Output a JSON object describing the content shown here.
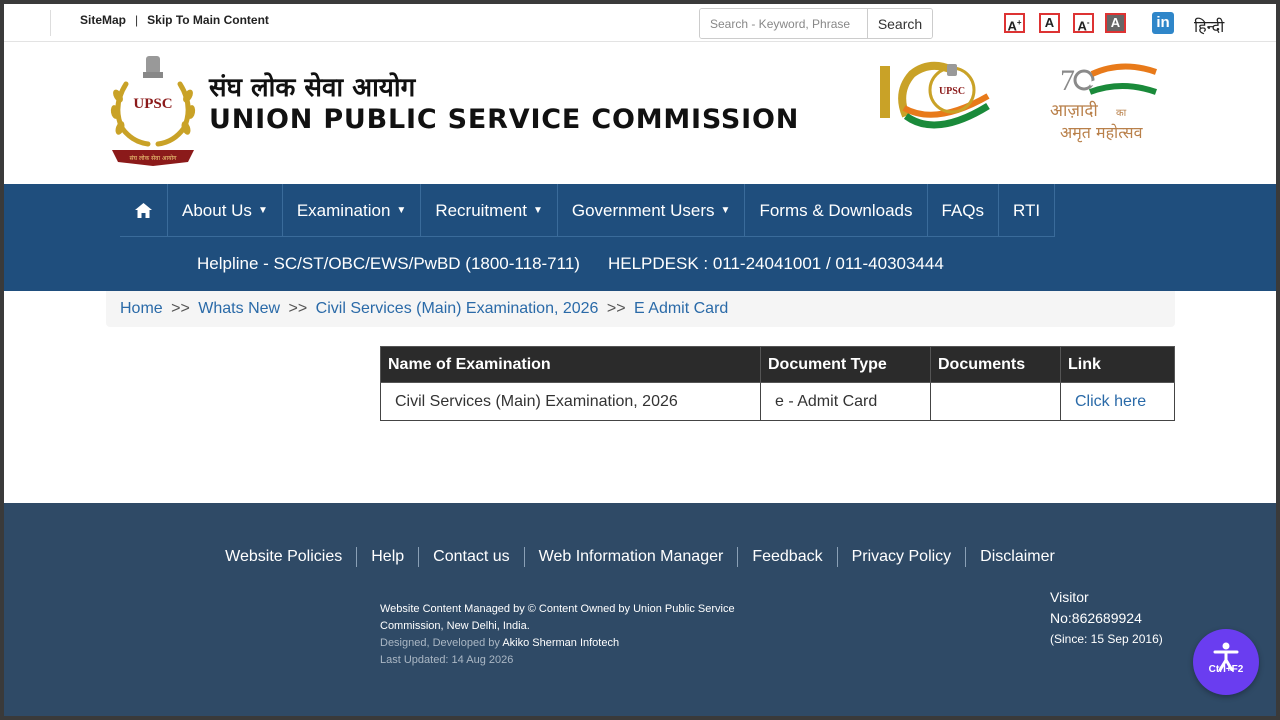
{
  "topbar": {
    "sitemap": "SiteMap",
    "separator": "|",
    "skip_content": "Skip To Main Content",
    "search_placeholder": "Search - Keyword, Phrase",
    "search_button": "Search",
    "font_increase": "A",
    "font_increase_sup": "+",
    "font_normal": "A",
    "font_decrease": "A",
    "font_decrease_sup": "-",
    "font_contrast": "A",
    "linkedin": "in",
    "hindi": "हिन्दी"
  },
  "header": {
    "title_hindi": "संघ लोक सेवा आयोग",
    "title_english": "UNION PUBLIC SERVICE COMMISSION",
    "logo_text": "UPSC",
    "logo_ribbon": "संघ लोक सेवा आयोग",
    "anniv_text": "UPSC",
    "azadi_line1": "आज़ादी",
    "azadi_ka": "का",
    "azadi_line2": "अमृत महोत्सव"
  },
  "nav": {
    "items": [
      {
        "label": "About Us",
        "dropdown": true
      },
      {
        "label": "Examination",
        "dropdown": true
      },
      {
        "label": "Recruitment",
        "dropdown": true
      },
      {
        "label": "Government Users",
        "dropdown": true
      },
      {
        "label": "Forms & Downloads",
        "dropdown": false
      },
      {
        "label": "FAQs",
        "dropdown": false
      },
      {
        "label": "RTI",
        "dropdown": false
      }
    ],
    "helpline": "Helpline - SC/ST/OBC/EWS/PwBD (1800-118-711)",
    "helpdesk": "HELPDESK : 011-24041001 / 011-40303444"
  },
  "breadcrumb": {
    "items": [
      "Home",
      "Whats New",
      "Civil Services (Main) Examination, 2026",
      "E Admit Card"
    ],
    "separator": ">>"
  },
  "table": {
    "headers": [
      "Name of Examination",
      "Document Type",
      "Documents",
      "Link"
    ],
    "rows": [
      {
        "name": "Civil Services (Main) Examination, 2026",
        "type": "e - Admit Card",
        "documents": "",
        "link": "Click here"
      }
    ]
  },
  "footer": {
    "links": [
      "Website Policies",
      "Help",
      "Contact us",
      "Web Information Manager",
      "Feedback",
      "Privacy Policy",
      "Disclaimer"
    ],
    "managed": "Website Content Managed by © Content Owned by Union Public Service Commission, New Delhi, India.",
    "designed_prefix": "Designed, Developed by",
    "designed_by": "Akiko Sherman Infotech",
    "last_updated": "Last Updated: 14 Aug 2026",
    "visitor_label": "Visitor",
    "visitor_no": "No:862689924",
    "visitor_since": "(Since: 15 Sep 2016)"
  },
  "a11y": {
    "label": "Ctrl+F2"
  },
  "colors": {
    "nav_bg": "#1f4e7d",
    "footer_bg": "#2f4a66",
    "link": "#2a6aa8",
    "table_header_bg": "#2b2b2b",
    "a11y_bg": "#6a3df0"
  }
}
